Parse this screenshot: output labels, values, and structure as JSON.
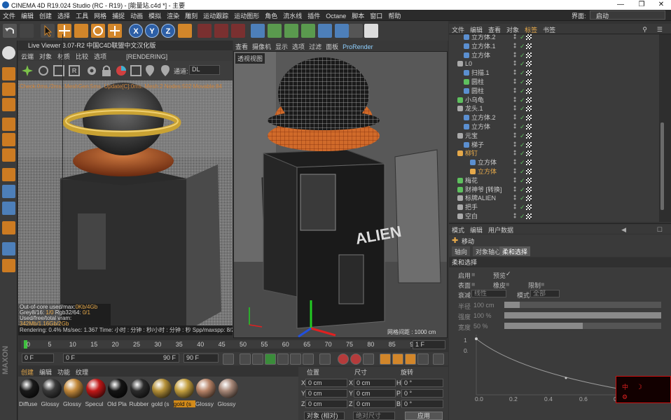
{
  "window": {
    "title": "CINEMA 4D R19.024 Studio (RC - R19) - [能量站.c4d *] - 主要",
    "layout_label": "界面:",
    "layout_value": "启动"
  },
  "menubar": [
    "文件",
    "编辑",
    "创建",
    "选择",
    "工具",
    "网格",
    "捕捉",
    "动画",
    "模拟",
    "渲染",
    "雕刻",
    "运动跟踪",
    "运动图形",
    "角色",
    "流水线",
    "插件",
    "Octane",
    "脚本",
    "窗口",
    "帮助"
  ],
  "live_viewer": {
    "title": "Live Viewer 3.07-R2 中国C4D联盟中文汉化版",
    "menu": [
      "云端",
      "对象",
      "材质",
      "比较",
      "选项",
      "[RENDERING]"
    ],
    "channel_label": "通道:",
    "channel_value": "DL",
    "check_line": "Check:0ms./2ms. MeshGen:5ms. Update[C]:0ms. Mesh:2 Nodes:502 Movable:84",
    "info": {
      "outofcore_label": "Out-of-core used/max:",
      "outofcore_value": "0Kb/4Gb",
      "grey_label": "Grey8/16: ",
      "grey_value": "1/0",
      "rgb_label": "Rgb32/64: ",
      "rgb_value": "0/1",
      "vram_label": "Used/free/total vram: ",
      "vram_value": "342Mb/1.16Gb/2Gb"
    },
    "status": "Rendering: 0.4%    Ms/sec: 1.367    Time: 小时 : 分钟 : 秒/小时 : 分钟 : 秒    Spp/maxspp: 8/2000    Tri"
  },
  "viewport": {
    "menu": [
      "查看",
      "摄像机",
      "显示",
      "选项",
      "过滤",
      "面板",
      "ProRender"
    ],
    "label": "透视视图",
    "grid_spacing": "网格间距 : 1000 cm"
  },
  "timeline": {
    "ticks": [
      "0",
      "5",
      "10",
      "15",
      "20",
      "25",
      "30",
      "35",
      "40",
      "45",
      "50",
      "55",
      "60",
      "65",
      "70",
      "75",
      "80",
      "85",
      "90"
    ],
    "frame_display": "1 F",
    "start_field": "0 F",
    "current_field": "0 F",
    "range_end_field": "90 F",
    "end_field": "90 F"
  },
  "materials": {
    "menu": [
      "创建",
      "编辑",
      "功能",
      "纹理"
    ],
    "items": [
      {
        "label": "Diffuse",
        "color": "#1a1a1a"
      },
      {
        "label": "Glossy",
        "color": "#3a3a3a"
      },
      {
        "label": "Glossy",
        "color": "#c48a3c"
      },
      {
        "label": "Specul",
        "color": "#c01818"
      },
      {
        "label": "Old Pla",
        "color": "#141414"
      },
      {
        "label": "Rubber",
        "color": "#2c2c2c"
      },
      {
        "label": "gold (s",
        "color": "#b49038"
      },
      {
        "label": "gold (s",
        "color": "#c4a040"
      },
      {
        "label": "Glossy",
        "color": "#b88468"
      },
      {
        "label": "Glossy",
        "color": "#a88878"
      }
    ]
  },
  "coordinates": {
    "headers": [
      "位置",
      "尺寸",
      "旋转"
    ],
    "rows": [
      {
        "pos_label": "X",
        "pos": "0 cm",
        "size_label": "X",
        "size": "0 cm",
        "rot_label": "H",
        "rot": "0 °"
      },
      {
        "pos_label": "Y",
        "pos": "0 cm",
        "size_label": "Y",
        "size": "0 cm",
        "rot_label": "P",
        "rot": "0 °"
      },
      {
        "pos_label": "Z",
        "pos": "0 cm",
        "size_label": "Z",
        "size": "0 cm",
        "rot_label": "B",
        "rot": "0 °"
      }
    ],
    "mode_object": "对象 (相对)",
    "mode_size": "绝对尺寸",
    "apply": "应用"
  },
  "object_manager": {
    "menu": [
      "文件",
      "编辑",
      "查看",
      "对象",
      "标签",
      "书签"
    ],
    "objects": [
      {
        "name": "立方体.2",
        "indent": 1,
        "color": "#5b8fd0"
      },
      {
        "name": "立方体.1",
        "indent": 1,
        "color": "#5b8fd0"
      },
      {
        "name": "立方体",
        "indent": 1,
        "color": "#5b8fd0"
      },
      {
        "name": "L0",
        "indent": 0,
        "color": "#aaaaaa"
      },
      {
        "name": "扫描.1",
        "indent": 1,
        "color": "#5b8fd0"
      },
      {
        "name": "圆柱",
        "indent": 1,
        "color": "#5ec05e"
      },
      {
        "name": "圆柱",
        "indent": 1,
        "color": "#5b8fd0"
      },
      {
        "name": "小乌龟",
        "indent": 0,
        "color": "#5ec05e"
      },
      {
        "name": "龙头.1",
        "indent": 0,
        "color": "#aaaaaa"
      },
      {
        "name": "立方体.2",
        "indent": 1,
        "color": "#5b8fd0"
      },
      {
        "name": "立方体",
        "indent": 1,
        "color": "#5b8fd0"
      },
      {
        "name": "元宝",
        "indent": 0,
        "color": "#aaaaaa"
      },
      {
        "name": "梯子",
        "indent": 1,
        "color": "#5b8fd0"
      },
      {
        "name": "柳钉",
        "indent": 0,
        "color": "#e6a94a"
      },
      {
        "name": "立方体",
        "indent": 2,
        "color": "#5b8fd0"
      },
      {
        "name": "立方体",
        "indent": 2,
        "color": "#e6a94a"
      },
      {
        "name": "梅花",
        "indent": 0,
        "color": "#5ec05e"
      },
      {
        "name": "财神爷 [转换]",
        "indent": 0,
        "color": "#5ec05e"
      },
      {
        "name": "标牌ALIEN",
        "indent": 0,
        "color": "#aaaaaa"
      },
      {
        "name": "把手",
        "indent": 0,
        "color": "#aaaaaa"
      },
      {
        "name": "空白",
        "indent": 0,
        "color": "#aaaaaa"
      }
    ]
  },
  "attributes": {
    "menu": [
      "模式",
      "编辑",
      "用户数据"
    ],
    "object_title": "移动",
    "tabs": [
      "轴向",
      "对象轴心",
      "柔和选择"
    ],
    "section": "柔和选择",
    "enable_label": "启用",
    "preview_label": "预览",
    "surface_label": "表面",
    "rubber_label": "橡皮",
    "limit_label": "限制",
    "mode_label": "模式",
    "mode_value": "全部",
    "falloff_label": "衰减",
    "falloff_value": "线性",
    "radius_label": "半径",
    "radius_value": "100 cm",
    "radius_level": 0.1,
    "strength_label": "强度",
    "strength_value": "100 %",
    "strength_level": 1.0,
    "width_label": "宽度",
    "width_value": "50 %",
    "width_level": 0.5,
    "curve_x_ticks": [
      "0.0",
      "0.2",
      "0.4",
      "0.6",
      "0.8"
    ],
    "curve_y_ticks": [
      "1",
      "0.8"
    ]
  }
}
